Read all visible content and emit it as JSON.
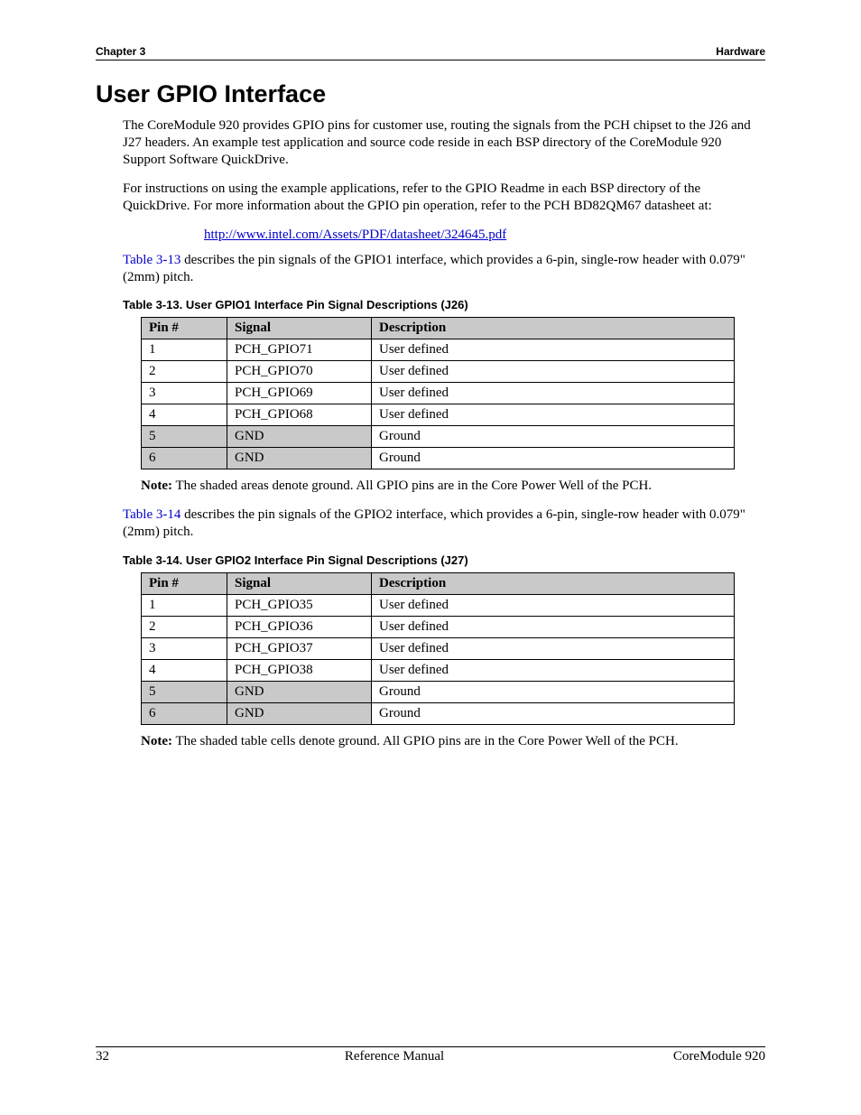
{
  "header": {
    "chapter": "Chapter 3",
    "section": "Hardware"
  },
  "title": "User GPIO Interface",
  "para1": "The CoreModule 920 provides GPIO pins for customer use, routing the signals from the PCH chipset to the J26 and J27 headers. An example test application and source code reside in each BSP directory of the CoreModule 920 Support Software QuickDrive.",
  "para2": "For instructions on using the example applications, refer to the GPIO Readme in each BSP directory of the QuickDrive. For more information about the GPIO pin operation, refer to the PCH BD82QM67 datasheet at:",
  "link": "http://www.intel.com/Assets/PDF/datasheet/324645.pdf",
  "ref1_label": "Table 3-13",
  "ref1_rest": " describes the pin signals of the GPIO1 interface, which provides a 6-pin, single-row header with 0.079\" (2mm) pitch.",
  "caption1": "Table 3-13.   User GPIO1 Interface Pin Signal Descriptions (J26)",
  "columns": {
    "c1": "Pin #",
    "c2": "Signal",
    "c3": "Description"
  },
  "table1": [
    {
      "pin": "1",
      "signal": "PCH_GPIO71",
      "desc": "User defined",
      "shaded": false
    },
    {
      "pin": "2",
      "signal": "PCH_GPIO70",
      "desc": "User defined",
      "shaded": false
    },
    {
      "pin": "3",
      "signal": "PCH_GPIO69",
      "desc": "User defined",
      "shaded": false
    },
    {
      "pin": "4",
      "signal": "PCH_GPIO68",
      "desc": "User defined",
      "shaded": false
    },
    {
      "pin": "5",
      "signal": "GND",
      "desc": "Ground",
      "shaded": true
    },
    {
      "pin": "6",
      "signal": "GND",
      "desc": "Ground",
      "shaded": true
    }
  ],
  "note_label": "Note:",
  "note1": "  The shaded areas denote ground. All GPIO pins are in the Core Power Well of the PCH.",
  "ref2_label": "Table 3-14",
  "ref2_rest": " describes the pin signals of the GPIO2 interface, which provides a 6-pin, single-row header with 0.079\" (2mm) pitch.",
  "caption2": "Table 3-14.   User GPIO2 Interface Pin Signal Descriptions (J27)",
  "table2": [
    {
      "pin": "1",
      "signal": "PCH_GPIO35",
      "desc": "User defined",
      "shaded": false
    },
    {
      "pin": "2",
      "signal": "PCH_GPIO36",
      "desc": "User defined",
      "shaded": false
    },
    {
      "pin": "3",
      "signal": "PCH_GPIO37",
      "desc": "User defined",
      "shaded": false
    },
    {
      "pin": "4",
      "signal": "PCH_GPIO38",
      "desc": "User defined",
      "shaded": false
    },
    {
      "pin": "5",
      "signal": "GND",
      "desc": "Ground",
      "shaded": true
    },
    {
      "pin": "6",
      "signal": "GND",
      "desc": "Ground",
      "shaded": true
    }
  ],
  "note2": "  The shaded table cells denote ground. All GPIO pins are in the Core Power Well of the PCH.",
  "footer": {
    "page": "32",
    "mid": "Reference Manual",
    "right": "CoreModule 920"
  }
}
